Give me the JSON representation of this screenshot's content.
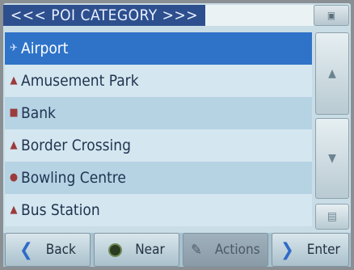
{
  "header": {
    "title": "<<< POI CATEGORY >>>",
    "top_button_icon": "minimize-icon"
  },
  "list": {
    "selected_index": 0,
    "items": [
      {
        "label": "Airport",
        "icon": "airport-icon"
      },
      {
        "label": "Amusement Park",
        "icon": "amusement-park-icon"
      },
      {
        "label": "Bank",
        "icon": "bank-icon"
      },
      {
        "label": "Border Crossing",
        "icon": "border-crossing-icon"
      },
      {
        "label": "Bowling Centre",
        "icon": "bowling-icon"
      },
      {
        "label": "Bus Station",
        "icon": "bus-station-icon"
      }
    ]
  },
  "scrollbar": {
    "up_icon": "arrow-up-icon",
    "down_icon": "arrow-down-icon",
    "list_icon": "list-view-icon"
  },
  "footer": {
    "back_label": "Back",
    "near_label": "Near",
    "actions_label": "Actions",
    "enter_label": "Enter"
  },
  "colors": {
    "title_bg": "#2d4f8e",
    "selected_row": "#2f73c9",
    "row_odd": "#b6d3e4",
    "row_even": "#d4e6ef"
  }
}
